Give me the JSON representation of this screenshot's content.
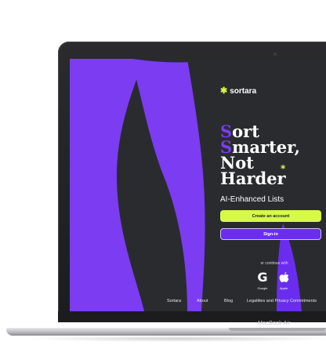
{
  "device": {
    "model_label": "MacBook Air"
  },
  "app": {
    "brand": "sortara",
    "brand_icon": "asterisk-star-icon",
    "headline": {
      "line1_initial": "S",
      "line1_rest": "ort",
      "line2_initial": "S",
      "line2_rest": "marter,",
      "line3": "Not",
      "line4": "Harder",
      "sparkle": "*"
    },
    "subheadline": "AI-Enhanced Lists",
    "create_account_label": "Create an account",
    "sign_in_label": "Sign-in",
    "continue_with": "or continue with",
    "social": [
      {
        "label": "Google",
        "icon": "google-icon",
        "glyph": "G"
      },
      {
        "label": "Apple",
        "icon": "apple-icon"
      }
    ],
    "footer": [
      "Sortara",
      "About",
      "Blog",
      "Legalities and Privacy Commitments"
    ]
  },
  "colors": {
    "accent_purple": "#7b3cf2",
    "accent_lime": "#d7f94a",
    "screen_dark": "#2a2b2f"
  }
}
